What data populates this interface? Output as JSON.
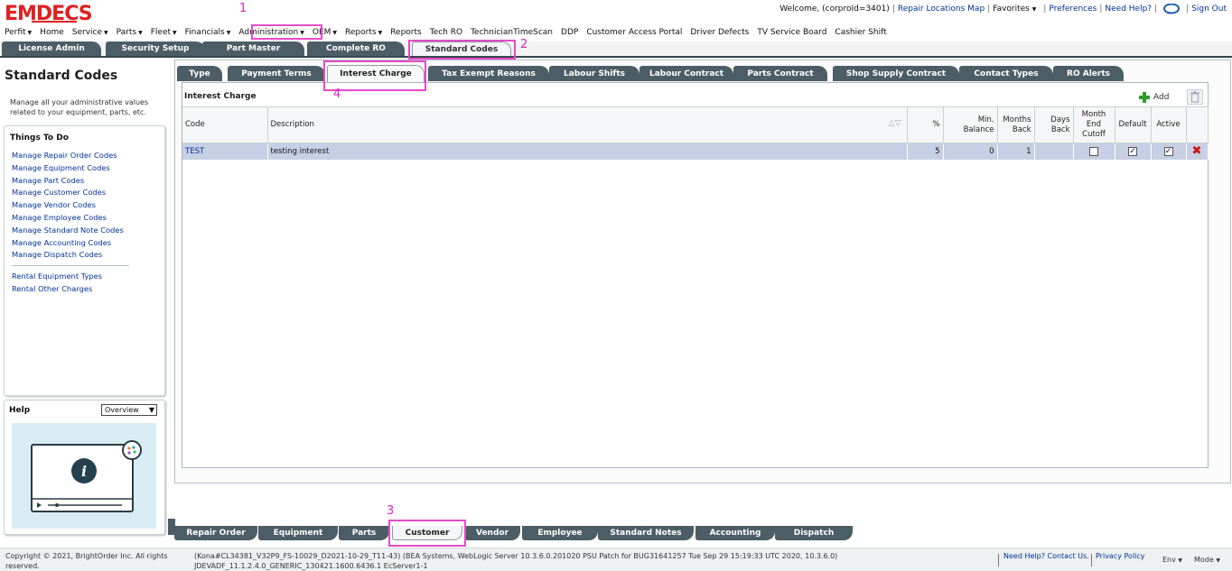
{
  "app": {
    "logo_text": "EMDECS",
    "colors": {
      "logo": "#e02020",
      "dark_tab": "#4c5d66",
      "link": "#003399",
      "selected_row": "#c6cfe3",
      "annotation": "#e020c8"
    }
  },
  "header": {
    "welcome": "Welcome, (corproId=3401)",
    "links": [
      "Repair Locations Map",
      "Favorites",
      "Preferences",
      "Need Help?",
      "Sign Out"
    ],
    "chat_icon": "chat-bubble-icon"
  },
  "menu": {
    "items": [
      {
        "label": "Perfit",
        "caret": true
      },
      {
        "label": "Home",
        "caret": false
      },
      {
        "label": "Service",
        "caret": true
      },
      {
        "label": "Parts",
        "caret": true
      },
      {
        "label": "Fleet",
        "caret": true
      },
      {
        "label": "Financials",
        "caret": true
      },
      {
        "label": "Administration",
        "caret": true
      },
      {
        "label": "OEM",
        "caret": true
      },
      {
        "label": "Reports",
        "caret": true
      },
      {
        "label": "Reports",
        "caret": false
      },
      {
        "label": "Tech RO",
        "caret": false
      },
      {
        "label": "TechnicianTimeScan",
        "caret": false
      },
      {
        "label": "DDP",
        "caret": false
      },
      {
        "label": "Customer Access Portal",
        "caret": false
      },
      {
        "label": "Driver Defects",
        "caret": false
      },
      {
        "label": "TV Service Board",
        "caret": false
      },
      {
        "label": "Cashier Shift",
        "caret": false
      }
    ]
  },
  "top_tabs": [
    "License Admin",
    "Security Setup",
    "Part Master",
    "Complete RO",
    "Standard Codes"
  ],
  "annotations": [
    "1",
    "2",
    "3",
    "4"
  ],
  "left": {
    "title": "Standard Codes",
    "description": "Manage all your administrative values related to your equipment, parts, etc.",
    "things_to_do_title": "Things To Do",
    "things_to_do": [
      "Manage Repair Order Codes",
      "Manage Equipment Codes",
      "Manage Part Codes",
      "Manage Customer Codes",
      "Manage Vendor Codes",
      "Manage Employee Codes",
      "Manage Standard Note Codes",
      "Manage Accounting Codes",
      "Manage Dispatch Codes"
    ],
    "other_links": [
      "Rental Equipment Types",
      "Rental Other Charges"
    ],
    "help_title": "Help",
    "help_select": "Overview"
  },
  "inner_tabs": [
    "Type",
    "Payment Terms",
    "Interest Charge",
    "Tax Exempt Reasons",
    "Labour Shifts",
    "Labour Contract",
    "Parts Contract",
    "Shop Supply Contract",
    "Contact Types",
    "RO Alerts"
  ],
  "panel": {
    "title": "Interest Charge",
    "add_label": "Add",
    "columns": [
      "Code",
      "Description",
      "%",
      "Min. Balance",
      "Months Back",
      "Days Back",
      "Month End Cutoff",
      "Default",
      "Active"
    ],
    "rows": [
      {
        "code": "TEST",
        "description": "testing interest",
        "percent": "5",
        "min_balance": "0",
        "months_back": "1",
        "days_back": "",
        "month_end_cutoff": false,
        "default": true,
        "active": true
      }
    ]
  },
  "bottom_tabs": [
    "Repair Order",
    "Equipment",
    "Parts",
    "Customer",
    "Vendor",
    "Employee",
    "Standard Notes",
    "Accounting",
    "Dispatch"
  ],
  "footer": {
    "copyright": "Copyright © 2021, BrightOrder Inc. All rights reserved.",
    "build": "(Kona#CL34381_V32P9_FS-10029_D2021-10-29_T11-43) (BEA Systems, WebLogic Server 10.3.6.0.201020 PSU Patch for BUG31641257 Tue Sep 29 15:19:33 UTC 2020, 10.3.6.0) JDEVADF_11.1.2.4.0_GENERIC_130421.1600.6436.1 EcServer1-1",
    "need_help": "Need Help? Contact Us.",
    "privacy": "Privacy Policy",
    "env": "Env",
    "mode": "Mode"
  }
}
